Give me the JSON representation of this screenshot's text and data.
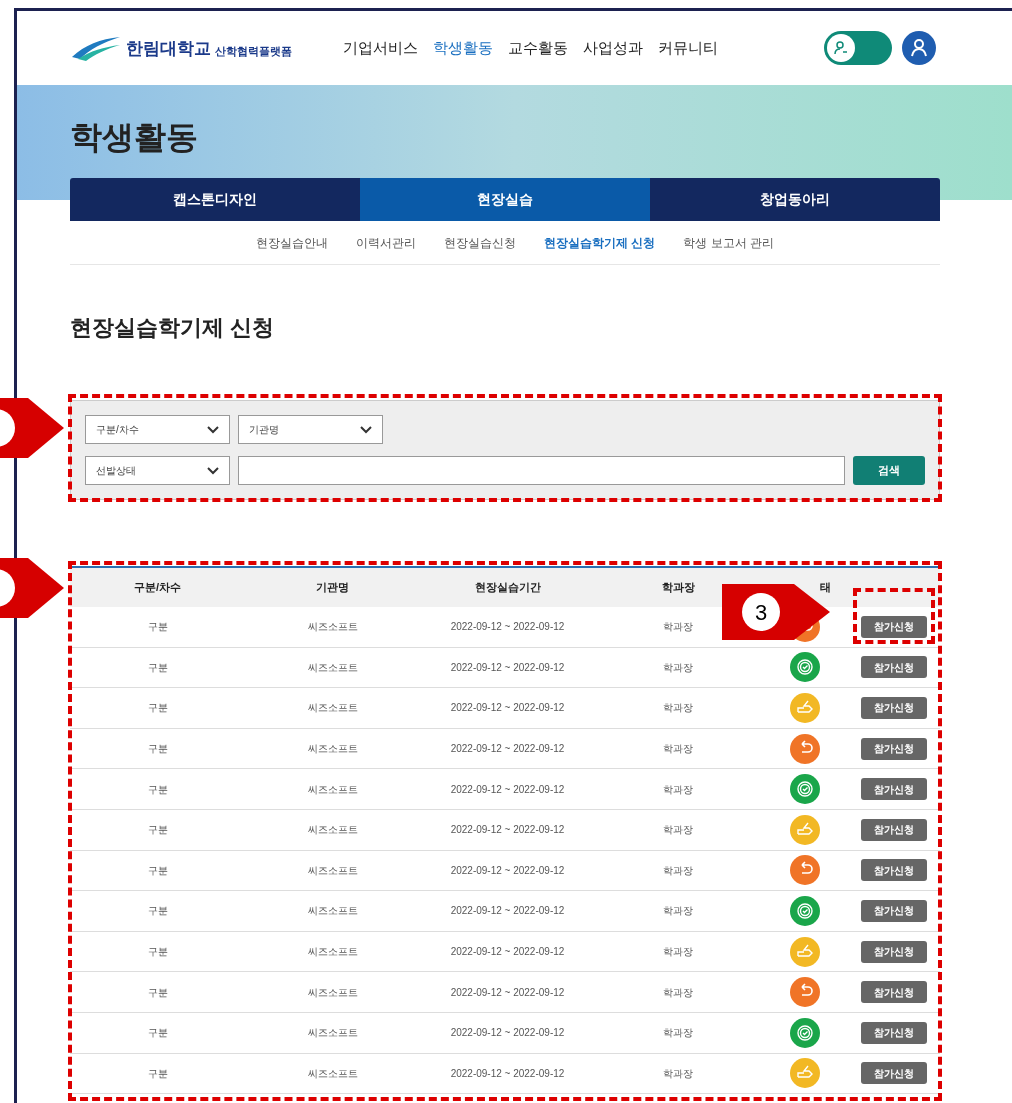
{
  "header": {
    "logo_name": "한림대학교",
    "logo_sub": "산학협력플랫폼",
    "nav": [
      {
        "label": "기업서비스",
        "selected": false
      },
      {
        "label": "학생활동",
        "selected": true
      },
      {
        "label": "교수활동",
        "selected": false
      },
      {
        "label": "사업성과",
        "selected": false
      },
      {
        "label": "커뮤니티",
        "selected": false
      }
    ]
  },
  "page_title": "학생활동",
  "tabs": [
    {
      "label": "캡스톤디자인",
      "selected": false
    },
    {
      "label": "현장실습",
      "selected": true
    },
    {
      "label": "창업동아리",
      "selected": false
    }
  ],
  "subtabs": [
    {
      "label": "현장실습안내",
      "selected": false
    },
    {
      "label": "이력서관리",
      "selected": false
    },
    {
      "label": "현장실습신청",
      "selected": false
    },
    {
      "label": "현장실습학기제 신청",
      "selected": true
    },
    {
      "label": "학생 보고서 관리",
      "selected": false
    }
  ],
  "heading": "현장실습학기제 신청",
  "filters": {
    "selects_row1": [
      "구분/차수",
      "기관명"
    ],
    "select_row2": "선발상태",
    "search_button": "검색"
  },
  "table": {
    "columns": [
      "구분/차수",
      "기관명",
      "현장실습기간",
      "학과장",
      "태"
    ],
    "rows": [
      {
        "cells": [
          "구분",
          "씨즈소프트",
          "2022-09-12 ~ 2022-09-12",
          "학과장"
        ],
        "status": {
          "kind": "undo",
          "color": "#f07427"
        },
        "button": "참가신청"
      },
      {
        "cells": [
          "구분",
          "씨즈소프트",
          "2022-09-12 ~ 2022-09-12",
          "학과장"
        ],
        "status": {
          "kind": "badge",
          "color": "#1aa64a"
        },
        "button": "참가신청"
      },
      {
        "cells": [
          "구분",
          "씨즈소프트",
          "2022-09-12 ~ 2022-09-12",
          "학과장"
        ],
        "status": {
          "kind": "hand",
          "color": "#f2b824"
        },
        "button": "참가신청"
      },
      {
        "cells": [
          "구분",
          "씨즈소프트",
          "2022-09-12 ~ 2022-09-12",
          "학과장"
        ],
        "status": {
          "kind": "undo",
          "color": "#f07427"
        },
        "button": "참가신청"
      },
      {
        "cells": [
          "구분",
          "씨즈소프트",
          "2022-09-12 ~ 2022-09-12",
          "학과장"
        ],
        "status": {
          "kind": "badge",
          "color": "#1aa64a"
        },
        "button": "참가신청"
      },
      {
        "cells": [
          "구분",
          "씨즈소프트",
          "2022-09-12 ~ 2022-09-12",
          "학과장"
        ],
        "status": {
          "kind": "hand",
          "color": "#f2b824"
        },
        "button": "참가신청"
      },
      {
        "cells": [
          "구분",
          "씨즈소프트",
          "2022-09-12 ~ 2022-09-12",
          "학과장"
        ],
        "status": {
          "kind": "undo",
          "color": "#f07427"
        },
        "button": "참가신청"
      },
      {
        "cells": [
          "구분",
          "씨즈소프트",
          "2022-09-12 ~ 2022-09-12",
          "학과장"
        ],
        "status": {
          "kind": "badge",
          "color": "#1aa64a"
        },
        "button": "참가신청"
      },
      {
        "cells": [
          "구분",
          "씨즈소프트",
          "2022-09-12 ~ 2022-09-12",
          "학과장"
        ],
        "status": {
          "kind": "hand",
          "color": "#f2b824"
        },
        "button": "참가신청"
      },
      {
        "cells": [
          "구분",
          "씨즈소프트",
          "2022-09-12 ~ 2022-09-12",
          "학과장"
        ],
        "status": {
          "kind": "undo",
          "color": "#f07427"
        },
        "button": "참가신청"
      },
      {
        "cells": [
          "구분",
          "씨즈소프트",
          "2022-09-12 ~ 2022-09-12",
          "학과장"
        ],
        "status": {
          "kind": "badge",
          "color": "#1aa64a"
        },
        "button": "참가신청"
      },
      {
        "cells": [
          "구분",
          "씨즈소프트",
          "2022-09-12 ~ 2022-09-12",
          "학과장"
        ],
        "status": {
          "kind": "hand",
          "color": "#f2b824"
        },
        "button": "참가신청"
      }
    ]
  },
  "callout": {
    "label": "3"
  }
}
